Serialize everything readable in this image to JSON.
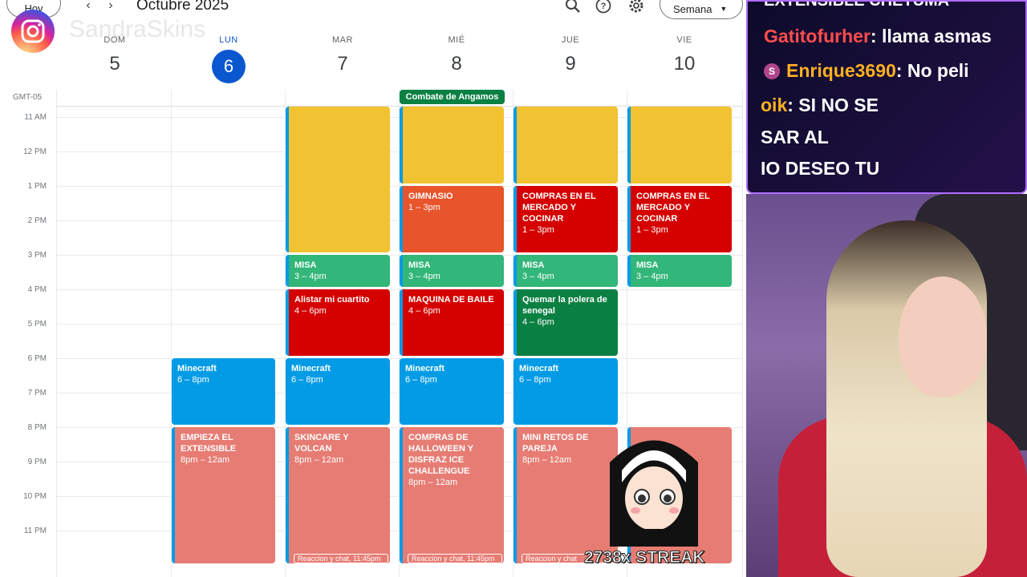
{
  "topbar": {
    "today_label": "Hoy",
    "month_title": "Octubre 2025",
    "view_label": "Semana"
  },
  "watermark": "SandraSkins",
  "timezone": "GMT-05",
  "days": [
    {
      "name": "DOM",
      "date": "5"
    },
    {
      "name": "LUN",
      "date": "6"
    },
    {
      "name": "MAR",
      "date": "7"
    },
    {
      "name": "MIÉ",
      "date": "8"
    },
    {
      "name": "JUE",
      "date": "9"
    },
    {
      "name": "VIE",
      "date": "10"
    }
  ],
  "hours": [
    "11 AM",
    "12 PM",
    "1 PM",
    "2 PM",
    "3 PM",
    "4 PM",
    "5 PM",
    "6 PM",
    "7 PM",
    "8 PM",
    "9 PM",
    "10 PM",
    "11 PM"
  ],
  "allday_event": "Combate de Angamos",
  "events": {
    "gym": {
      "title": "GIMNASIO",
      "time": "1 – 3pm"
    },
    "compras_jue": {
      "title": "COMPRAS EN EL MERCADO Y COCINAR",
      "time": "1 – 3pm"
    },
    "compras_vie": {
      "title": "COMPRAS EN EL MERCADO Y COCINAR",
      "time": "1 – 3pm"
    },
    "misa_mar": {
      "title": "MISA",
      "time": "3 – 4pm"
    },
    "misa_mie": {
      "title": "MISA",
      "time": "3 – 4pm"
    },
    "misa_jue": {
      "title": "MISA",
      "time": "3 – 4pm"
    },
    "misa_vie": {
      "title": "MISA",
      "time": "3 – 4pm"
    },
    "alistar": {
      "title": "Alistar mi cuartito",
      "time": "4 – 6pm"
    },
    "maquina": {
      "title": "MAQUINA DE BAILE",
      "time": "4 – 6pm"
    },
    "quemar": {
      "title": "Quemar la polera de senegal",
      "time": "4 – 6pm"
    },
    "mc_lun": {
      "title": "Minecraft",
      "time": "6 – 8pm"
    },
    "mc_mar": {
      "title": "Minecraft",
      "time": "6 – 8pm"
    },
    "mc_mie": {
      "title": "Minecraft",
      "time": "6 – 8pm"
    },
    "mc_jue": {
      "title": "Minecraft",
      "time": "6 – 8pm"
    },
    "empieza": {
      "title": "EMPIEZA EL EXTENSIBLE",
      "time": "8pm – 12am"
    },
    "skincare": {
      "title": "SKINCARE Y VOLCAN",
      "time": "8pm – 12am"
    },
    "halloween": {
      "title": "COMPRAS DE HALLOWEEN Y DISFRAZ ICE CHALLENGUE",
      "time": "8pm – 12am"
    },
    "retos": {
      "title": "MINI RETOS DE PAREJA",
      "time": "8pm – 12am"
    }
  },
  "chat_chips": {
    "mar": "Reaccion y chat, 11:45pm",
    "mie": "Reaccion y chat, 11:45pm",
    "jue": "Reaccion y chat"
  },
  "chat": {
    "header": "EXTENSIBLE CHETUMA",
    "messages": [
      {
        "user": "Gatitofurher",
        "text": ": llama asmas"
      },
      {
        "user": "Enrique3690",
        "text": ": No peli"
      },
      {
        "user": "oik",
        "text": ": SI NO SE"
      },
      {
        "user": "",
        "text": "SAR AL"
      },
      {
        "user": "",
        "text": "IO DESEO TU"
      }
    ]
  },
  "streak": "2738x STREAK",
  "colors": {
    "yellow": "#f1c232",
    "orange": "#e8542b",
    "red": "#d50000",
    "green": "#33b679",
    "darkgreen": "#0b8043",
    "blue": "#039be5",
    "salmon": "#e67c73",
    "accent": "#0b57d0"
  }
}
